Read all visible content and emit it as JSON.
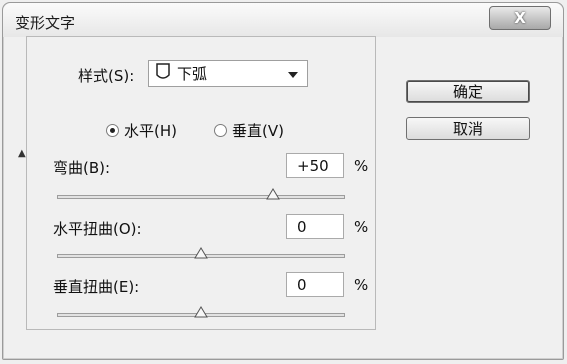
{
  "window": {
    "title": "变形文字",
    "close_label": "X"
  },
  "style": {
    "label": "样式(S):",
    "value": "下弧",
    "icon": "arc-lower-icon"
  },
  "orientation": {
    "horizontal_label": "水平(H)",
    "vertical_label": "垂直(V)",
    "selected": "horizontal"
  },
  "bend": {
    "label": "弯曲(B):",
    "value": "+50",
    "unit": "%",
    "slider_level": 0.75
  },
  "hdistort": {
    "label": "水平扭曲(O):",
    "value": "0",
    "unit": "%",
    "slider_level": 0.5
  },
  "vdistort": {
    "label": "垂直扭曲(E):",
    "value": "0",
    "unit": "%",
    "slider_level": 0.5
  },
  "buttons": {
    "ok": "确定",
    "cancel": "取消"
  },
  "colors": {
    "window_bg": "#f0f0f0",
    "titlebar_close": "#a8a8a8"
  }
}
